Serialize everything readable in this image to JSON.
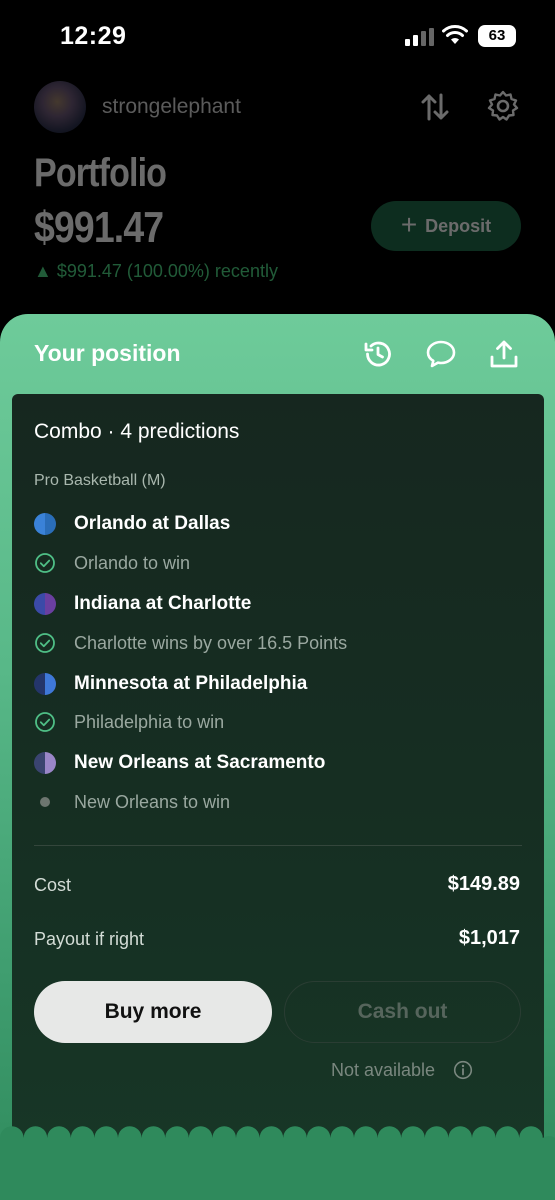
{
  "status_bar": {
    "time": "12:29",
    "battery": "63"
  },
  "header": {
    "username": "strongelephant"
  },
  "portfolio": {
    "title": "Portfolio",
    "value": "$991.47",
    "change": "▲ $991.47 (100.00%) recently",
    "deposit_label": "Deposit"
  },
  "position": {
    "title": "Your position",
    "combo_title": "Combo · 4 predictions",
    "league": "Pro Basketball (M)",
    "legs": [
      {
        "game": "Orlando at Dallas",
        "pick": "Orlando to win",
        "status": "won",
        "colors": [
          "#3a82d8",
          "#2a6db8"
        ]
      },
      {
        "game": "Indiana at Charlotte",
        "pick": "Charlotte wins by over 16.5 Points",
        "status": "won",
        "colors": [
          "#3b4aa8",
          "#6a3fa0"
        ]
      },
      {
        "game": "Minnesota at Philadelphia",
        "pick": "Philadelphia to win",
        "status": "won",
        "colors": [
          "#24356a",
          "#3f78d8"
        ]
      },
      {
        "game": "New Orleans at Sacramento",
        "pick": "New Orleans to win",
        "status": "pending",
        "colors": [
          "#3a4470",
          "#9a86c8"
        ]
      }
    ],
    "cost_label": "Cost",
    "cost_value": "$149.89",
    "payout_label": "Payout if right",
    "payout_value": "$1,017",
    "buy_more_label": "Buy more",
    "cash_out_label": "Cash out",
    "not_available_text": "Not available"
  }
}
